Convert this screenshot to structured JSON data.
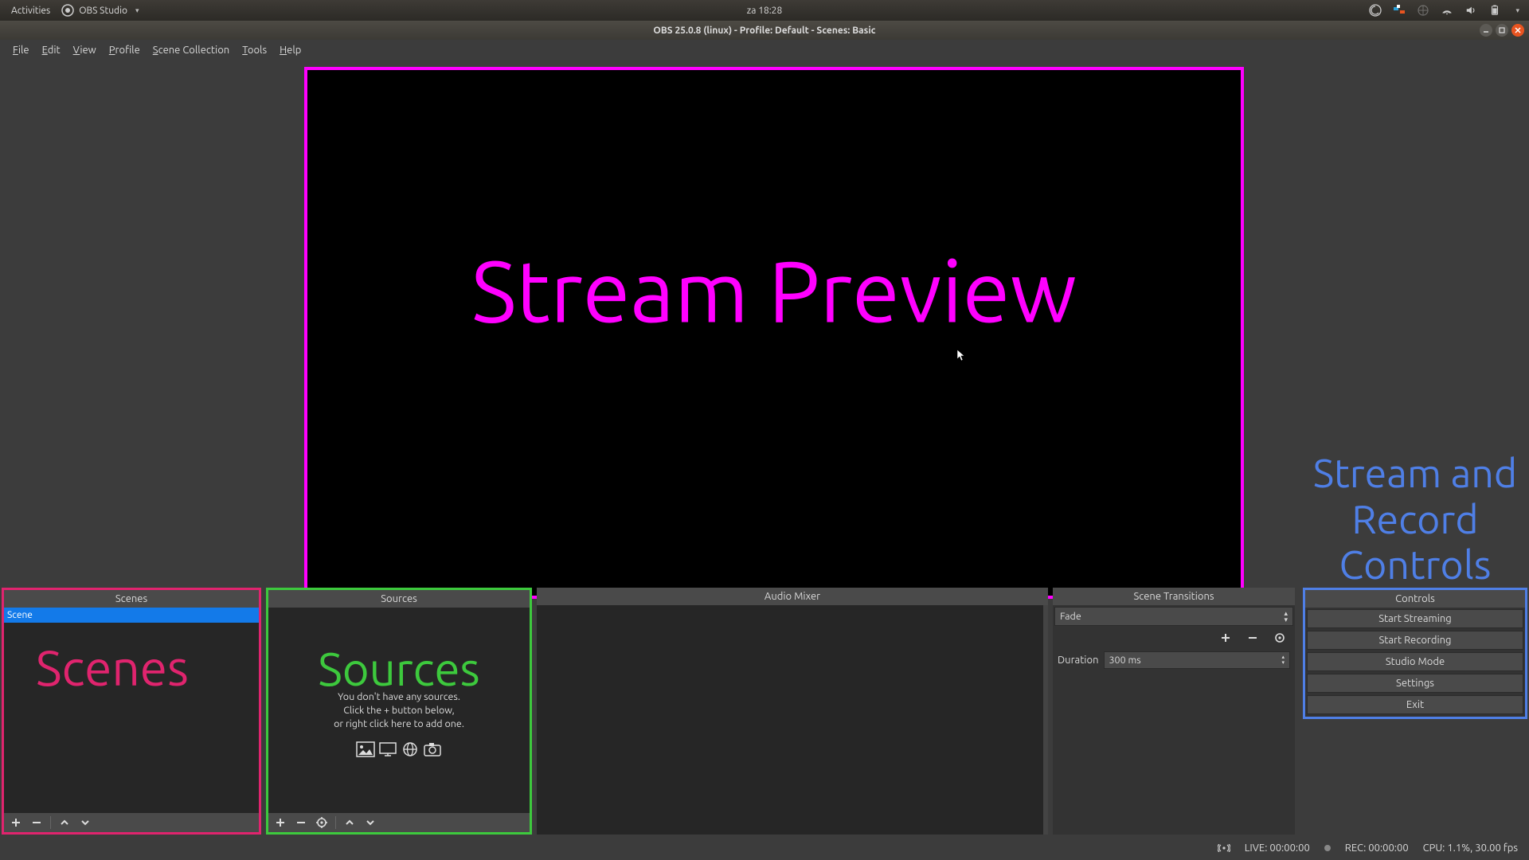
{
  "gnome_bar": {
    "activities": "Activities",
    "app_name": "OBS Studio",
    "clock": "za 18:28"
  },
  "window": {
    "title": "OBS 25.0.8 (linux) - Profile: Default - Scenes: Basic"
  },
  "menu": {
    "items": [
      "File",
      "Edit",
      "View",
      "Profile",
      "Scene Collection",
      "Tools",
      "Help"
    ]
  },
  "preview": {
    "overlay": "Stream Preview"
  },
  "controls_overlay": "Stream and Record Controls",
  "scenes": {
    "title": "Scenes",
    "overlay": "Scenes",
    "items": [
      "Scene"
    ]
  },
  "sources": {
    "title": "Sources",
    "overlay": "Sources",
    "help_line1": "You don't have any sources.",
    "help_line2": "Click the + button below,",
    "help_line3": "or right click here to add one."
  },
  "mixer": {
    "title": "Audio Mixer"
  },
  "transitions": {
    "title": "Scene Transitions",
    "selected": "Fade",
    "duration_label": "Duration",
    "duration_value": "300 ms"
  },
  "controls": {
    "title": "Controls",
    "start_streaming": "Start Streaming",
    "start_recording": "Start Recording",
    "studio_mode": "Studio Mode",
    "settings": "Settings",
    "exit": "Exit"
  },
  "status": {
    "live": "LIVE: 00:00:00",
    "rec": "REC: 00:00:00",
    "cpu": "CPU: 1.1%, 30.00 fps"
  }
}
